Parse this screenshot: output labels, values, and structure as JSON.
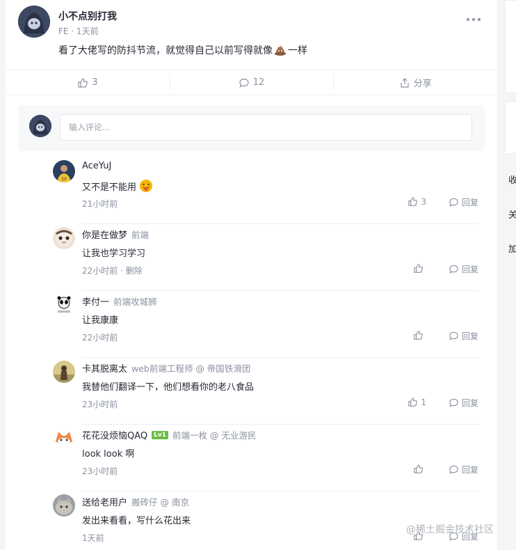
{
  "post": {
    "author": "小不点别打我",
    "meta": "FE · 1天前",
    "content_before": "看了大佬写的防抖节流，就觉得自己以前写得就像",
    "content_after": "一样",
    "content_icon": "poop-emoji"
  },
  "actions": {
    "like_count": "3",
    "comment_count": "12",
    "share_label": "分享"
  },
  "comment_input": {
    "placeholder": "输入评论..."
  },
  "comments": [
    {
      "name": "AceYuJ",
      "sub": "",
      "badge": "",
      "text": "又不是不能用",
      "emoji": "tongue-emoji",
      "time": "21小时前",
      "likes": "3",
      "reply": "回复",
      "avatar_color": "#2b3f5f"
    },
    {
      "name": "你是在做梦",
      "sub": "前端",
      "badge": "",
      "text": "让我也学习学习",
      "emoji": "",
      "time": "22小时前 · 删除",
      "likes": "",
      "reply": "回复",
      "avatar_color": "#e9d8c6"
    },
    {
      "name": "李付一",
      "sub": "前端攻城狮",
      "badge": "",
      "text": "让我康康",
      "emoji": "",
      "time": "22小时前",
      "likes": "",
      "reply": "回复",
      "avatar_color": "#f1f1f1"
    },
    {
      "name": "卡其脱离太",
      "sub": "web前端工程师 @ 帝国铁滑团",
      "badge": "",
      "text": "我替他们翻译一下，他们想看你的老八食品",
      "emoji": "",
      "time": "23小时前",
      "likes": "1",
      "reply": "回复",
      "avatar_color": "#c7b36a"
    },
    {
      "name": "花花没烦恼QAQ",
      "sub": "前端一枚 @ 无业游民",
      "badge": "Lv1",
      "text": "look look 啊",
      "emoji": "",
      "time": "23小时前",
      "likes": "",
      "reply": "回复",
      "avatar_color": "#f08a4b"
    },
    {
      "name": "送给老用户",
      "sub": "搬砖仔 @ 南京",
      "badge": "",
      "text": "发出来看看，写什么花出来",
      "emoji": "",
      "time": "1天前",
      "likes": "",
      "reply": "回复",
      "avatar_color": "#8c8f95"
    }
  ],
  "sidebar": {
    "items": [
      "收",
      "关",
      "加"
    ]
  },
  "watermark": "@稀土掘金技术社区",
  "colors": {
    "text": "#252933",
    "muted": "#8a919f",
    "badge": "#6cbd45"
  }
}
